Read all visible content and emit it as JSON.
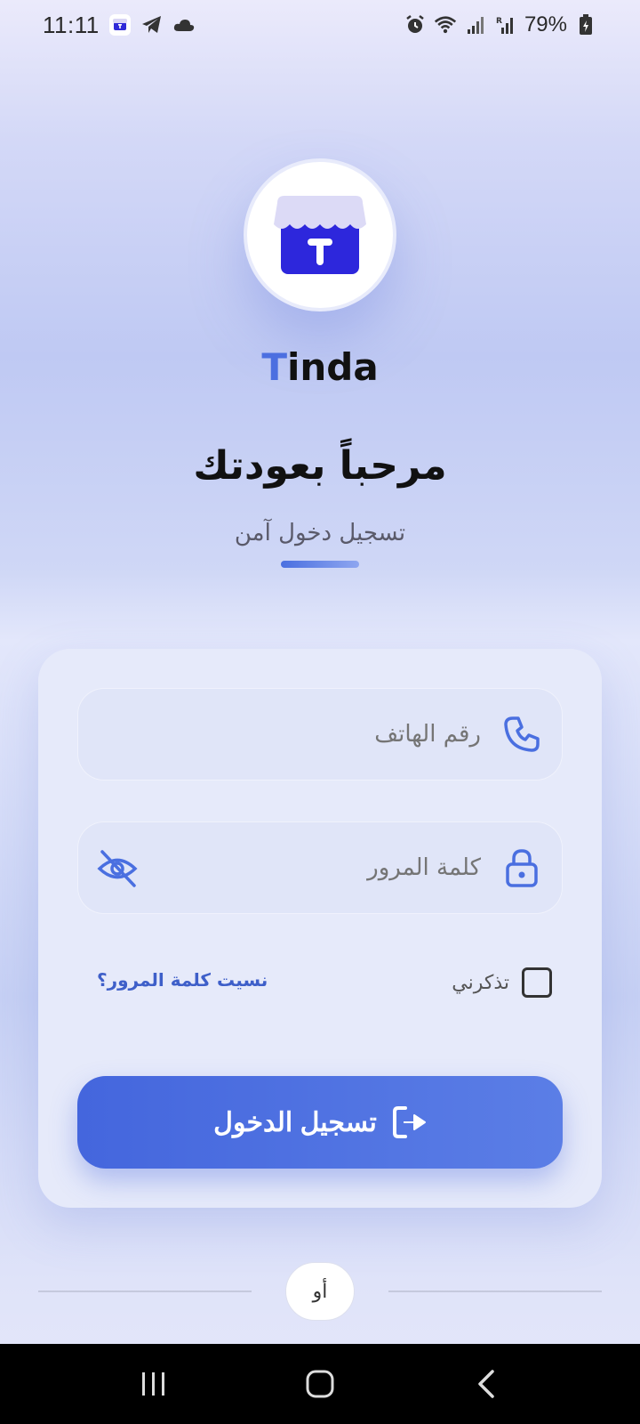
{
  "status_bar": {
    "time": "11:11",
    "battery_pct": "79%",
    "icons_left": [
      "tinda-app-icon",
      "telegram-icon",
      "cloud-icon"
    ],
    "icons_right": [
      "alarm-icon",
      "wifi-icon",
      "signal-icon",
      "signal-roaming-icon",
      "battery-charging-icon"
    ]
  },
  "brand": {
    "logo": "store-icon",
    "name_initial": "T",
    "name_rest": "inda",
    "accent_color": "#4c6fe0"
  },
  "header": {
    "title": "مرحباً بعودتك",
    "subtitle": "تسجيل دخول آمن"
  },
  "form": {
    "phone_placeholder": "رقم الهاتف",
    "password_placeholder": "كلمة المرور",
    "remember_label": "تذكرني",
    "forgot_label": "نسيت كلمة المرور؟",
    "login_label": "تسجيل الدخول"
  },
  "divider": {
    "or_label": "أو"
  },
  "nav_bar": {
    "buttons": [
      "recents-icon",
      "home-icon",
      "back-icon"
    ]
  }
}
